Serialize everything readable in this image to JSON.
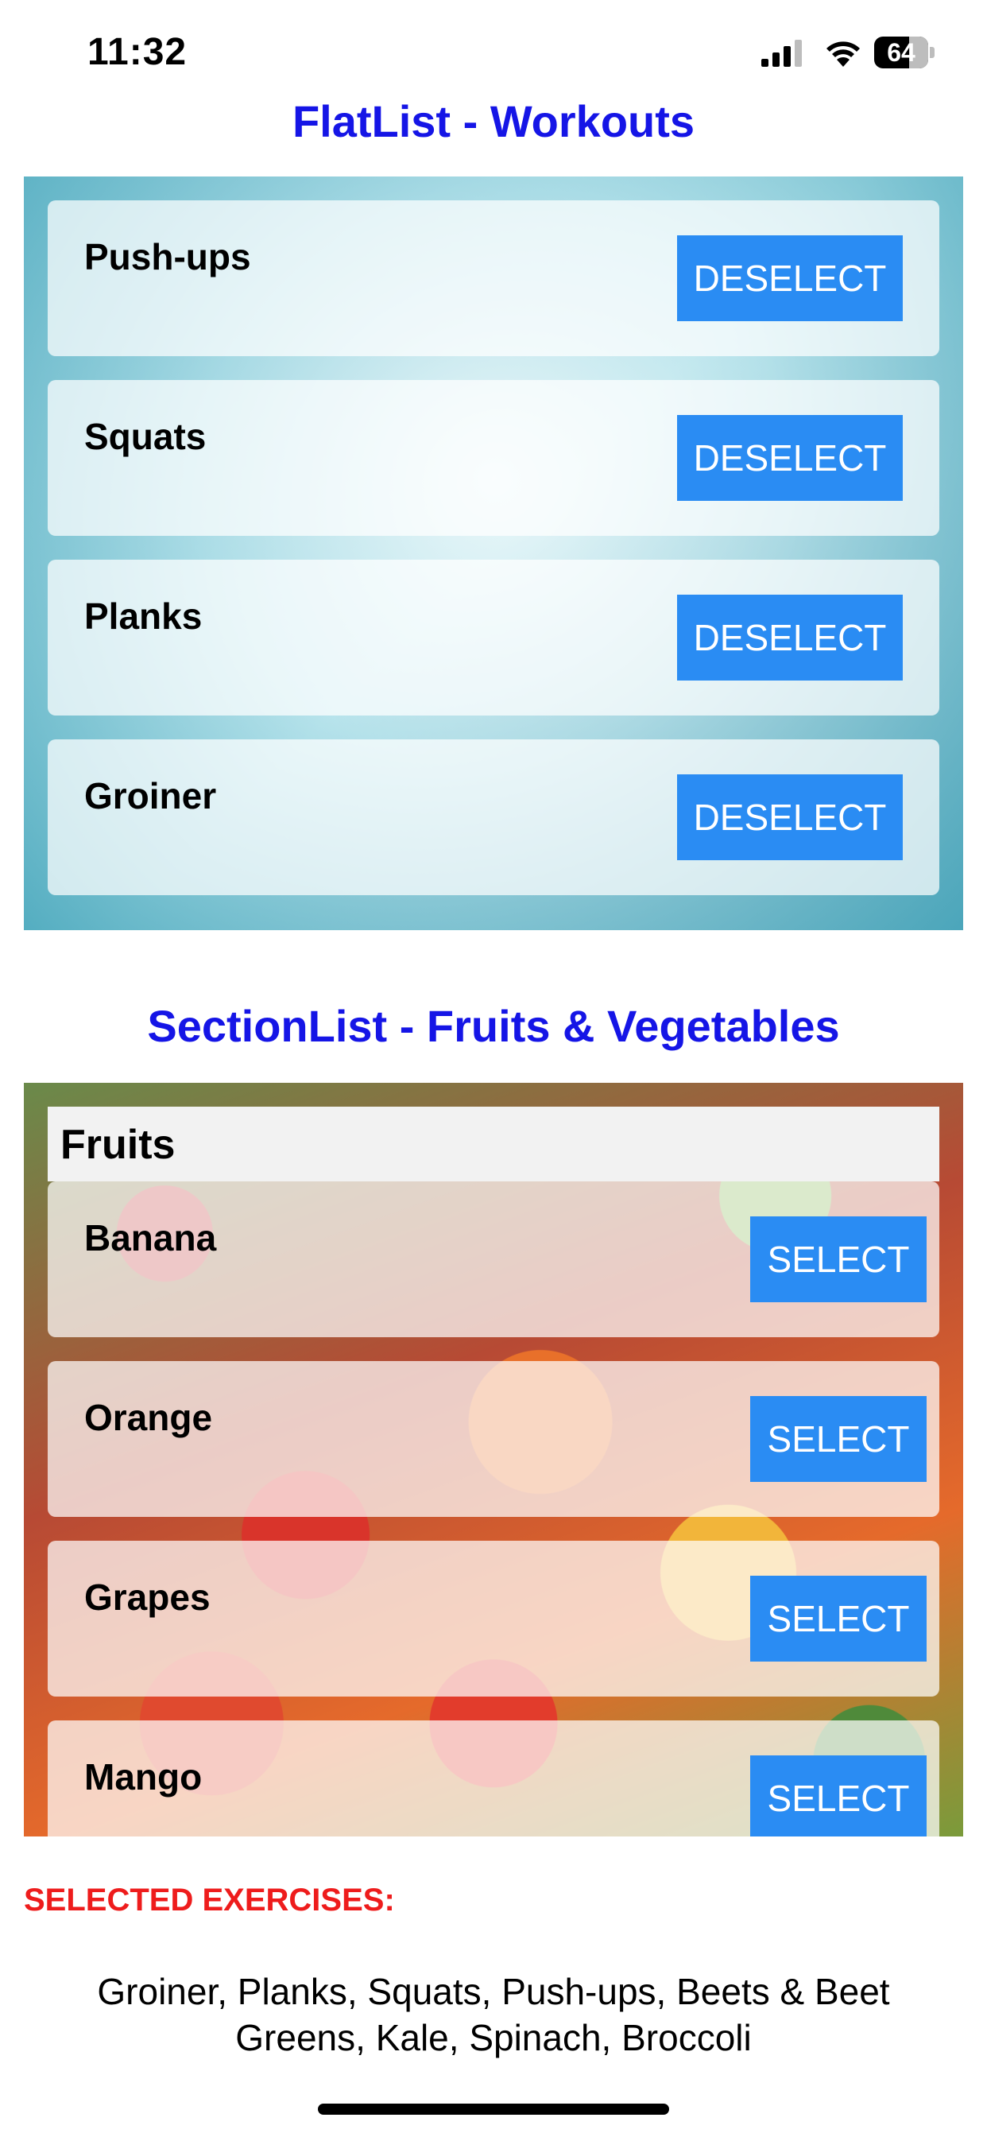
{
  "status_bar": {
    "time": "11:32",
    "battery_level": "64",
    "icons": [
      "signal-icon",
      "wifi-icon",
      "battery-icon"
    ]
  },
  "workouts": {
    "title": "FlatList - Workouts",
    "items": [
      {
        "label": "Push-ups",
        "button": "DESELECT"
      },
      {
        "label": "Squats",
        "button": "DESELECT"
      },
      {
        "label": "Planks",
        "button": "DESELECT"
      },
      {
        "label": "Groiner",
        "button": "DESELECT"
      }
    ]
  },
  "produce": {
    "title": "SectionList - Fruits & Vegetables",
    "section_header": "Fruits",
    "items": [
      {
        "label": "Banana",
        "button": "SELECT"
      },
      {
        "label": "Orange",
        "button": "SELECT"
      },
      {
        "label": "Grapes",
        "button": "SELECT"
      },
      {
        "label": "Mango",
        "button": "SELECT"
      }
    ]
  },
  "selected": {
    "heading": "SELECTED EXERCISES:",
    "text": "Groiner, Planks, Squats, Push-ups, Beets & Beet Greens, Kale, Spinach, Broccoli"
  },
  "colors": {
    "title": "#1515e6",
    "button": "#2a8cf3",
    "heading": "#ee1c1c"
  }
}
